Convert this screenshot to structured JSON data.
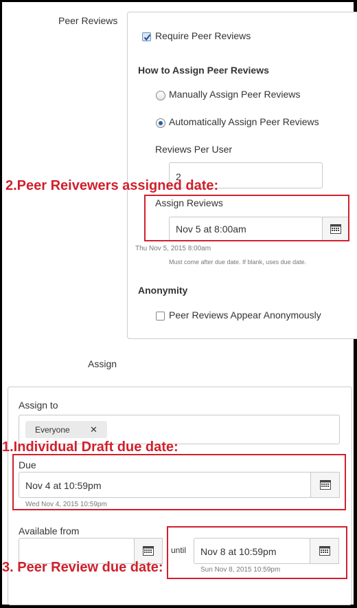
{
  "peer_reviews": {
    "section_label": "Peer Reviews",
    "require_label": "Require Peer Reviews",
    "require_checked": true,
    "how_to_title": "How to Assign Peer Reviews",
    "manual_label": "Manually Assign Peer Reviews",
    "automatic_label": "Automatically Assign Peer Reviews",
    "selected_mode": "automatic",
    "reviews_per_user_label": "Reviews Per User",
    "reviews_per_user_value": "2",
    "assign_reviews_label": "Assign Reviews",
    "assign_reviews_value": "Nov 5 at 8:00am",
    "assign_reviews_full": "Thu Nov 5, 2015 8:00am",
    "assign_reviews_hint": "Must come after due date. If blank, uses due date.",
    "anonymity_title": "Anonymity",
    "anonymous_label": "Peer Reviews Appear Anonymously",
    "anonymous_checked": false
  },
  "assign": {
    "section_label": "Assign",
    "assign_to_label": "Assign to",
    "assignee_tag": "Everyone",
    "remove_symbol": "✕",
    "due_label": "Due",
    "due_value": "Nov 4 at 10:59pm",
    "due_full": "Wed Nov 4, 2015 10:59pm",
    "available_from_label": "Available from",
    "available_from_value": "",
    "until_label": "until",
    "until_value": "Nov 8 at 10:59pm",
    "until_full": "Sun Nov 8, 2015 10:59pm"
  },
  "annotations": {
    "reviewers_assigned": "2.Peer Reivewers assigned date:",
    "draft_due": "1.Individual Draft due date:",
    "review_due": "3. Peer Review due date:"
  },
  "icons": {
    "calendar": "calendar-icon",
    "checkbox": "checkmark-icon",
    "remove": "close-icon"
  },
  "colors": {
    "annotation_red": "#d0202c",
    "radio_selected": "#1f5fa8"
  }
}
